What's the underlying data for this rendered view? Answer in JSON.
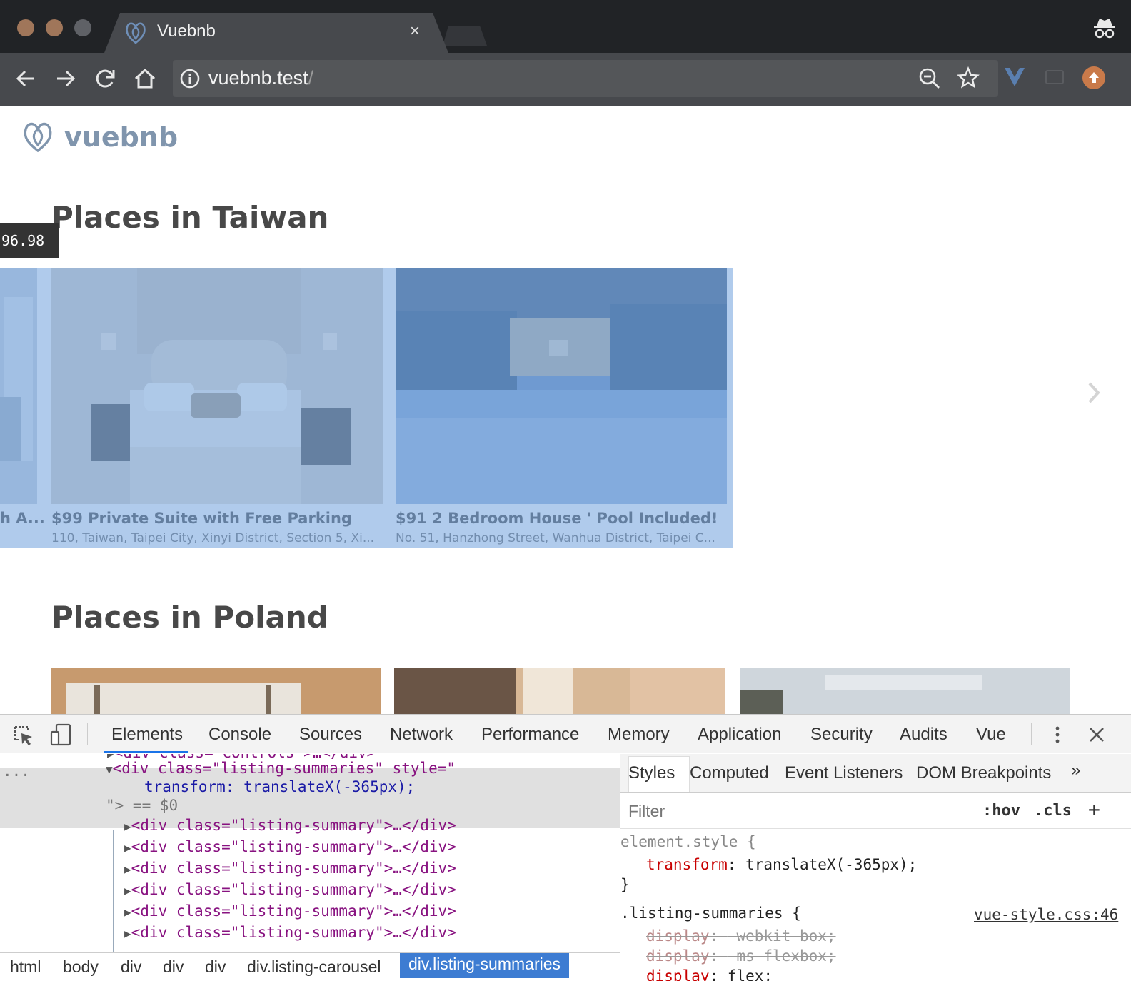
{
  "browser": {
    "tab_title": "Vuebnb",
    "tab_close": "×",
    "url_host": "vuebnb.test",
    "url_path": "/"
  },
  "page": {
    "logo_text": "vuebnb",
    "size_badge": "96.98",
    "sections": [
      {
        "title": "Places in Taiwan",
        "listings": [
          {
            "title": "h A...",
            "address": ""
          },
          {
            "title": "$99 Private Suite with Free Parking",
            "address": "110, Taiwan, Taipei City, Xinyi District, Section 5, Xi..."
          },
          {
            "title": "$91 2 Bedroom House ' Pool Included!",
            "address": "No. 51, Hanzhong Street, Wanhua District, Taipei C..."
          }
        ]
      },
      {
        "title": "Places in Poland"
      }
    ]
  },
  "devtools": {
    "tabs": [
      "Elements",
      "Console",
      "Sources",
      "Network",
      "Performance",
      "Memory",
      "Application",
      "Security",
      "Audits",
      "Vue"
    ],
    "active_tab": "Elements",
    "dom": {
      "partial_line": "<div class=\"controls\">…</div>",
      "ellipsis": "...",
      "selected_open": "<div class=\"listing-summaries\" style=\"",
      "selected_style": "transform: translateX(-365px);",
      "selected_close": "\"> == $0",
      "children": [
        "<div class=\"listing-summary\">…</div>",
        "<div class=\"listing-summary\">…</div>",
        "<div class=\"listing-summary\">…</div>",
        "<div class=\"listing-summary\">…</div>",
        "<div class=\"listing-summary\">…</div>",
        "<div class=\"listing-summary\">…</div>"
      ]
    },
    "styles_tabs": [
      "Styles",
      "Computed",
      "Event Listeners",
      "DOM Breakpoints"
    ],
    "styles_more": "»",
    "filter_placeholder": "Filter",
    "filter_hov": ":hov",
    "filter_cls": ".cls",
    "filter_add": "+",
    "rules": {
      "element_selector": "element.style {",
      "element_prop": "transform",
      "element_value": "translateX(-365px);",
      "close_brace": "}",
      "class_selector": ".listing-summaries {",
      "source": "vue-style.css:46",
      "struck_1_prop": "display",
      "struck_1_value": "-webkit-box;",
      "struck_2_prop": "display",
      "struck_2_value": "-ms-flexbox;",
      "active_prop": "display",
      "active_value": "flex;"
    },
    "breadcrumbs": [
      "html",
      "body",
      "div",
      "div",
      "div",
      "div.listing-carousel",
      "div.listing-summaries"
    ]
  },
  "colors": {
    "highlight_overlay": "#6fa0dc",
    "breadcrumb_active": "#3d7cd2",
    "logo": "#8095ad"
  },
  "icons": [
    "back-icon",
    "forward-icon",
    "reload-icon",
    "home-icon",
    "info-icon",
    "zoom-icon",
    "star-icon",
    "vue-devtools-icon",
    "incognito-icon",
    "chevron-right-icon",
    "inspect-icon",
    "device-icon",
    "more-icon",
    "close-icon"
  ]
}
